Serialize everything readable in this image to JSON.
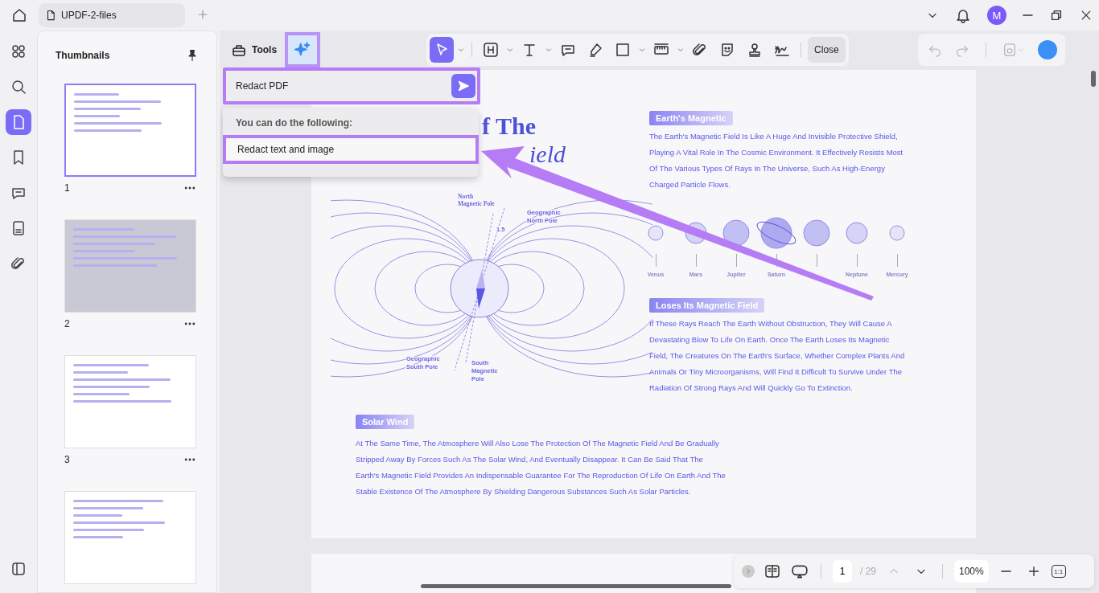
{
  "tab_bar": {
    "tab_title": "UPDF-2-files",
    "avatar_letter": "M"
  },
  "sidebar_rail": {
    "items": [
      {
        "kind": "apps",
        "selected": false
      },
      {
        "kind": "search",
        "selected": false
      },
      {
        "kind": "pages",
        "selected": true
      },
      {
        "kind": "bookmark",
        "selected": false
      },
      {
        "kind": "comment",
        "selected": false
      },
      {
        "kind": "form",
        "selected": false
      },
      {
        "kind": "attachment",
        "selected": false
      }
    ]
  },
  "thumbnails": {
    "title": "Thumbnails",
    "pages": [
      {
        "number": "1",
        "selected": true,
        "kind": "light"
      },
      {
        "number": "2",
        "selected": false,
        "kind": "gray"
      },
      {
        "number": "3",
        "selected": false,
        "kind": "light"
      },
      {
        "selected": false,
        "kind": "light"
      }
    ]
  },
  "toolbar": {
    "tools_label": "Tools",
    "ai_highlighted": true,
    "tools": [
      {
        "kind": "select",
        "selected": true,
        "caret": true
      },
      {
        "kind": "heading",
        "selected": false,
        "caret": true
      },
      {
        "kind": "text",
        "selected": false,
        "caret": true
      },
      {
        "kind": "comment",
        "selected": false,
        "caret": false
      },
      {
        "kind": "highlighter",
        "selected": false,
        "caret": false
      },
      {
        "kind": "shape",
        "selected": false,
        "caret": true
      },
      {
        "kind": "strikeout",
        "selected": false,
        "caret": true
      },
      {
        "kind": "attachment",
        "selected": false,
        "caret": false
      },
      {
        "kind": "sticker",
        "selected": false,
        "caret": false
      },
      {
        "kind": "stamp",
        "selected": false,
        "caret": false
      },
      {
        "kind": "signature",
        "selected": false,
        "caret": false
      }
    ],
    "close_label": "Close"
  },
  "ai_prompt": {
    "value": "Redact PDF",
    "highlighted": true,
    "suggestions_heading": "You can do the following:",
    "suggestions": [
      {
        "label": "Redact text and image",
        "highlighted": true
      }
    ]
  },
  "document": {
    "title_lines": [
      "f The",
      "ield"
    ],
    "diagram_labels": [
      {
        "kind": "north-magnetic",
        "lines": [
          "North",
          "Magnetic Pole"
        ]
      },
      {
        "kind": "north-geo",
        "lines": [
          "Geographic",
          "North Pole"
        ]
      },
      {
        "kind": "angle",
        "lines": [
          "1.5"
        ]
      },
      {
        "kind": "south-geo",
        "lines": [
          "Geographic",
          "South Pole"
        ]
      },
      {
        "kind": "south-magnetic",
        "lines": [
          "South",
          "Magnetic",
          "Pole"
        ]
      }
    ],
    "sections": [
      {
        "heading": "Earth's Magnetic",
        "paragraph": "The Earth's Magnetic Field Is Like A Huge And Invisible Protective Shield, Playing A Vital Role In The Cosmic Environment. It Effectively Resists Most Of The Various Types Of Rays In The Universe, Such As High-Energy Charged Particle Flows."
      },
      {
        "heading": "Loses Its Magnetic Field",
        "paragraph": "If These Rays Reach The Earth Without Obstruction, They Will Cause A Devastating Blow To Life On Earth. Once The Earth Loses Its Magnetic Field, The Creatures On The Earth's Surface, Whether Complex Plants And Animals Or Tiny Microorganisms, Will Find It Difficult To Survive Under The Radiation Of Strong Rays And Will Quickly Go To Extinction."
      },
      {
        "heading": "Solar Wind",
        "paragraph": "At The Same Time, The Atmosphere Will Also Lose The Protection Of The Magnetic Field And Be Gradually Stripped Away By Forces Such As The Solar Wind, And Eventually Disappear. It Can Be Said That The Earth's Magnetic Field Provides An Indispensable Guarantee For The Reproduction Of Life On Earth And The Stable Existence Of The Atmosphere By Shielding Dangerous Substances Such As Solar Particles."
      }
    ],
    "planets": [
      {
        "name": "Venus",
        "kind": "small"
      },
      {
        "name": "Mars",
        "kind": "medium"
      },
      {
        "name": "Jupiter",
        "kind": "large"
      },
      {
        "name": "Saturn",
        "kind": "ringed"
      },
      {
        "kind": "large"
      },
      {
        "name": "Neptune",
        "kind": "medium"
      },
      {
        "name": "Mercury",
        "kind": "small"
      }
    ]
  },
  "page_nav": {
    "current_page": "1",
    "total": "/ 29",
    "zoom": "100%",
    "actual_size": "1:1"
  }
}
